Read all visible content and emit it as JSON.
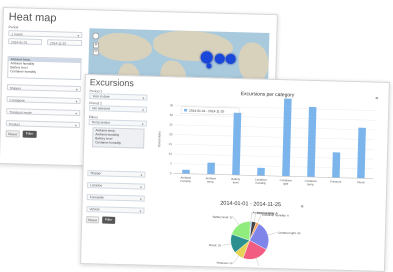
{
  "heatmap": {
    "title": "Heat map",
    "period_label": "Period",
    "preset_value": "1 month",
    "date_from": "2014-01-01",
    "date_to": "2014-11-25",
    "categories": [
      "Ambient temp.",
      "Ambient humidity",
      "Battery level",
      "Container humidity"
    ],
    "selected_category_index": 0,
    "filters": [
      "Shipper",
      "Consignee",
      "Transport mode",
      "Product"
    ],
    "reset_label": "Reset",
    "filter_label": "Filter"
  },
  "excursions": {
    "title": "Excursions",
    "period_label": "Period 1",
    "preset_value": "Year to date",
    "period2_label": "Period 2",
    "period2_value": "Not selected",
    "filters_label": "Filters",
    "filters_field": "Temp sensor",
    "categories": [
      "Ambient temp.",
      "Ambient humidity",
      "Battery level",
      "Container humidity"
    ],
    "dropdowns": [
      "Shipper",
      "Location",
      "Forwarder",
      "Vehicle"
    ],
    "reset_label": "Reset",
    "filter_label": "Filter",
    "menu_icon": "hamburger-icon"
  },
  "chart_data": [
    {
      "type": "bar",
      "title": "Excursions per category",
      "legend": [
        "2014-01-01 - 2014-11-25"
      ],
      "legend_position": "top-left",
      "ylabel": "Excursions",
      "ylim": [
        0,
        35
      ],
      "yticks": [
        0,
        5,
        10,
        15,
        20,
        25,
        30,
        35
      ],
      "categories": [
        "Ambient humidity",
        "Ambient temp.",
        "Battery level",
        "Container humidity",
        "Container light",
        "Container temp.",
        "Pressure",
        "Shock"
      ],
      "series": [
        {
          "name": "2014-01-01 - 2014-11-25",
          "values": [
            2,
            6,
            32,
            4,
            40,
            36,
            13,
            26
          ]
        }
      ],
      "color": "#7cb5ec",
      "grid": true
    },
    {
      "type": "pie",
      "title": "2014-01-01 - 2014-11-25",
      "slices": [
        {
          "label": "Ambient humidity",
          "value": 2,
          "color": "#7cb5ec"
        },
        {
          "label": "Ambient temp.",
          "value": 6,
          "color": "#434348"
        },
        {
          "label": "Container humidity",
          "value": 4,
          "color": "#f7a35c"
        },
        {
          "label": "Container light",
          "value": 40,
          "color": "#8085e9"
        },
        {
          "label": "Container temp.",
          "value": 36,
          "color": "#f15c80"
        },
        {
          "label": "Pressure",
          "value": 13,
          "color": "#e4d354"
        },
        {
          "label": "Shock",
          "value": 26,
          "color": "#2b908f"
        },
        {
          "label": "Battery level",
          "value": 32,
          "color": "#90ed7d"
        }
      ]
    }
  ]
}
